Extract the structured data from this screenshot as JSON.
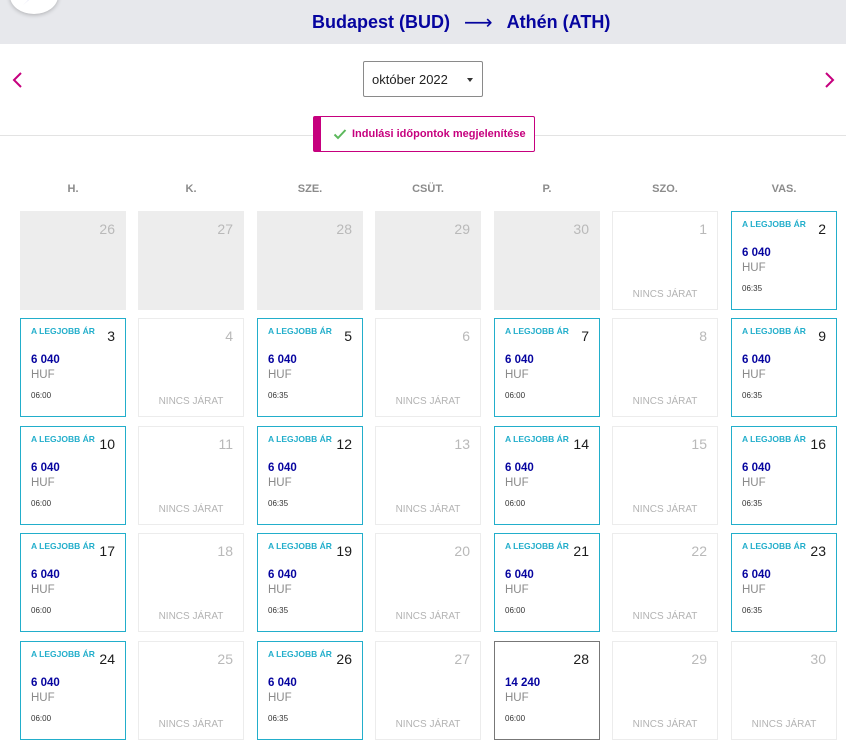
{
  "header": {
    "origin": "Budapest (BUD)",
    "route_arrow": "⟶",
    "destination": "Athén (ATH)"
  },
  "month_select": {
    "value": "október 2022"
  },
  "toggle": {
    "label": "Indulási időpontok megjelenítése"
  },
  "weekdays": [
    "H.",
    "K.",
    "SZE.",
    "CSÜT.",
    "P.",
    "SZO.",
    "VAS."
  ],
  "calendar": {
    "best_price_label": "A LEGJOBB ÁR",
    "no_flight_label": "NINCS JÁRAT",
    "days": [
      {
        "day": "26",
        "state": "past"
      },
      {
        "day": "27",
        "state": "past"
      },
      {
        "day": "28",
        "state": "past"
      },
      {
        "day": "29",
        "state": "past"
      },
      {
        "day": "30",
        "state": "past"
      },
      {
        "day": "1",
        "state": "noflight"
      },
      {
        "day": "2",
        "state": "flight",
        "best": true,
        "price": "6 040",
        "currency": "HUF",
        "time": "06:35"
      },
      {
        "day": "3",
        "state": "flight",
        "best": true,
        "price": "6 040",
        "currency": "HUF",
        "time": "06:00"
      },
      {
        "day": "4",
        "state": "noflight"
      },
      {
        "day": "5",
        "state": "flight",
        "best": true,
        "price": "6 040",
        "currency": "HUF",
        "time": "06:35"
      },
      {
        "day": "6",
        "state": "noflight"
      },
      {
        "day": "7",
        "state": "flight",
        "best": true,
        "price": "6 040",
        "currency": "HUF",
        "time": "06:00"
      },
      {
        "day": "8",
        "state": "noflight"
      },
      {
        "day": "9",
        "state": "flight",
        "best": true,
        "price": "6 040",
        "currency": "HUF",
        "time": "06:35"
      },
      {
        "day": "10",
        "state": "flight",
        "best": true,
        "price": "6 040",
        "currency": "HUF",
        "time": "06:00"
      },
      {
        "day": "11",
        "state": "noflight"
      },
      {
        "day": "12",
        "state": "flight",
        "best": true,
        "price": "6 040",
        "currency": "HUF",
        "time": "06:35"
      },
      {
        "day": "13",
        "state": "noflight"
      },
      {
        "day": "14",
        "state": "flight",
        "best": true,
        "price": "6 040",
        "currency": "HUF",
        "time": "06:00"
      },
      {
        "day": "15",
        "state": "noflight"
      },
      {
        "day": "16",
        "state": "flight",
        "best": true,
        "price": "6 040",
        "currency": "HUF",
        "time": "06:35"
      },
      {
        "day": "17",
        "state": "flight",
        "best": true,
        "price": "6 040",
        "currency": "HUF",
        "time": "06:00"
      },
      {
        "day": "18",
        "state": "noflight"
      },
      {
        "day": "19",
        "state": "flight",
        "best": true,
        "price": "6 040",
        "currency": "HUF",
        "time": "06:35"
      },
      {
        "day": "20",
        "state": "noflight"
      },
      {
        "day": "21",
        "state": "flight",
        "best": true,
        "price": "6 040",
        "currency": "HUF",
        "time": "06:00"
      },
      {
        "day": "22",
        "state": "noflight"
      },
      {
        "day": "23",
        "state": "flight",
        "best": true,
        "price": "6 040",
        "currency": "HUF",
        "time": "06:35"
      },
      {
        "day": "24",
        "state": "flight",
        "best": true,
        "price": "6 040",
        "currency": "HUF",
        "time": "06:00"
      },
      {
        "day": "25",
        "state": "noflight"
      },
      {
        "day": "26",
        "state": "flight",
        "best": true,
        "price": "6 040",
        "currency": "HUF",
        "time": "06:35"
      },
      {
        "day": "27",
        "state": "noflight"
      },
      {
        "day": "28",
        "state": "flight",
        "best": false,
        "price": "14 240",
        "currency": "HUF",
        "time": "06:00"
      },
      {
        "day": "29",
        "state": "noflight"
      },
      {
        "day": "30",
        "state": "noflight"
      }
    ]
  },
  "colors": {
    "brand_navy": "#06049f",
    "accent_magenta": "#c6007e",
    "best_price_teal": "#22aecb",
    "check_green": "#5cb85c"
  },
  "icons": {
    "logo": "wizz-logo-icon",
    "prev": "chevron-left-icon",
    "next": "chevron-right-icon",
    "check": "check-icon",
    "caret": "caret-down-icon"
  }
}
